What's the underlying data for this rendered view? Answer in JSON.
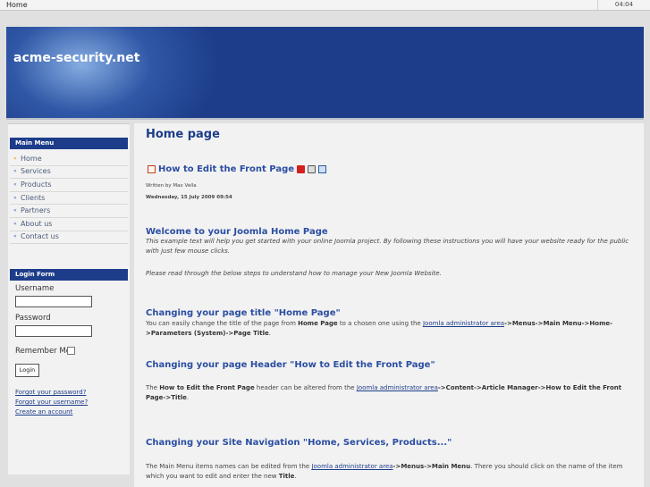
{
  "browser": {
    "tab_label": "Home",
    "clock": "04:04"
  },
  "header": {
    "site_title": "acme-security.net"
  },
  "main_menu": {
    "title": "Main Menu",
    "items": [
      "Home",
      "Services",
      "Products",
      "Clients",
      "Partners",
      "About us",
      "Contact us"
    ]
  },
  "login_form": {
    "title": "Login Form",
    "username_label": "Username",
    "password_label": "Password",
    "remember_label": "Remember Me",
    "login_button": "Login",
    "forgot_password": "Forgot your password?",
    "forgot_username": "Forgot your username?",
    "create_account": "Create an account"
  },
  "content": {
    "page_title": "Home page",
    "article_title": "How to Edit the Front Page",
    "written_by": "Written by Max Vella",
    "date": "Wednesday, 15 July 2009 09:54",
    "welcome_heading": "Welcome to your Joomla Home Page",
    "welcome_text": "This example text will help you get started with your online Joomla project. By following these instructions you will have your website ready for the public with just few mouse clicks.",
    "read_through_text": "Please read through the below steps to understand how to manage your New Joomla Website.",
    "s1_heading": "Changing your page title \"Home Page\"",
    "s1_t1": "You can easily change the title of the page from ",
    "s1_b1": "Home Page",
    "s1_t2": " to a chosen one using the ",
    "s1_link": "Joomla administrator area",
    "s1_b2": "->Menus->Main Menu->Home->Parameters (System)->Page Title",
    "s1_t3": ".",
    "s2_heading": "Changing your page Header \"How to Edit the Front Page\"",
    "s2_t1": "The ",
    "s2_b1": "How to Edit the Front Page",
    "s2_t2": " header can be altered from the ",
    "s2_link": "Joomla administrator area",
    "s2_b2": "->Content->Article Manager->How to Edit the Front Page->Title",
    "s2_t3": ".",
    "s3_heading": "Changing your Site Navigation \"Home, Services, Products...\"",
    "s3_t1": "The Main Menu items names can be edited from the ",
    "s3_link": "Joomla administrator area",
    "s3_b1": "->Menus->Main Menu",
    "s3_t2": ". There you should click on the name of the item which you want to edit and enter the new ",
    "s3_b2": "Title",
    "s3_t3": "."
  },
  "colors": {
    "brand_blue": "#1d3d8a",
    "link_blue": "#2b4ea2",
    "active_arrow": "#e5a100"
  }
}
